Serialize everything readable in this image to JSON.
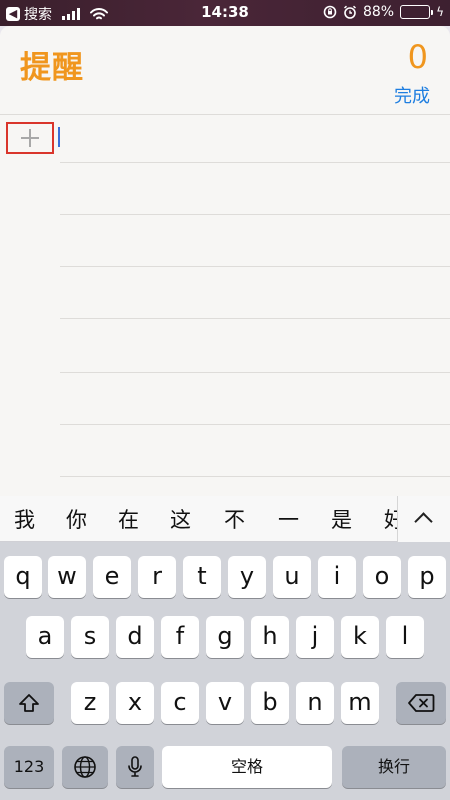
{
  "status_bar": {
    "back_label": "搜索",
    "time": "14:38",
    "battery": "88%",
    "battery_level": 0.88
  },
  "reminders": {
    "title": "提醒",
    "count": "0",
    "done_label": "完成"
  },
  "candidates": [
    "我",
    "你",
    "在",
    "这",
    "不",
    "一",
    "是",
    "好"
  ],
  "keyboard": {
    "row1": [
      "q",
      "w",
      "e",
      "r",
      "t",
      "y",
      "u",
      "i",
      "o",
      "p"
    ],
    "row2": [
      "a",
      "s",
      "d",
      "f",
      "g",
      "h",
      "j",
      "k",
      "l"
    ],
    "row3": [
      "z",
      "x",
      "c",
      "v",
      "b",
      "n",
      "m"
    ],
    "numbers_label": "123",
    "space_label": "空格",
    "return_label": "换行"
  },
  "icons": {
    "back": "back-arrow-icon",
    "signal": "signal-icon",
    "wifi": "wifi-icon",
    "rotation_lock": "rotation-lock-icon",
    "alarm": "alarm-icon",
    "battery": "battery-icon",
    "charging": "bolt-icon",
    "add": "plus-icon",
    "expand": "chevron-up-icon",
    "shift": "shift-icon",
    "delete": "delete-icon",
    "globe": "globe-icon",
    "mic": "mic-icon"
  },
  "colors": {
    "accent": "#f0961e",
    "link": "#1e7ee0",
    "highlight": "#d9352b"
  }
}
